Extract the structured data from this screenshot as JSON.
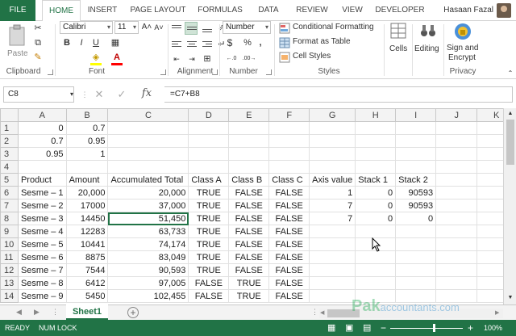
{
  "ribbon_tabs": [
    "FILE",
    "HOME",
    "INSERT",
    "PAGE LAYOUT",
    "FORMULAS",
    "DATA",
    "REVIEW",
    "VIEW",
    "DEVELOPER"
  ],
  "user_name": "Hasaan Fazal",
  "clipboard": {
    "paste_label": "Paste",
    "group_label": "Clipboard"
  },
  "font": {
    "name": "Calibri",
    "size": "11",
    "bold": "B",
    "italic": "I",
    "underline": "U",
    "group_label": "Font"
  },
  "alignment": {
    "group_label": "Alignment"
  },
  "number": {
    "format": "Number",
    "currency": "$",
    "percent": "%",
    "comma": ",",
    "group_label": "Number"
  },
  "styles": {
    "conditional": "Conditional Formatting",
    "format_table": "Format as Table",
    "cell_styles": "Cell Styles",
    "group_label": "Styles"
  },
  "cells": {
    "label": "Cells"
  },
  "editing": {
    "label": "Editing"
  },
  "privacy": {
    "sign_label": "Sign and",
    "encrypt_label": "Encrypt",
    "group_label": "Privacy"
  },
  "name_box": "C8",
  "formula": "=C7+B8",
  "fx_label": "fx",
  "columns": [
    "A",
    "B",
    "C",
    "D",
    "E",
    "F",
    "G",
    "H",
    "I",
    "J",
    "K"
  ],
  "rows": [
    {
      "n": "1",
      "cells": [
        "0",
        "0.7",
        "",
        "",
        "",
        "",
        "",
        "",
        "",
        "",
        ""
      ]
    },
    {
      "n": "2",
      "cells": [
        "0.7",
        "0.95",
        "",
        "",
        "",
        "",
        "",
        "",
        "",
        "",
        ""
      ]
    },
    {
      "n": "3",
      "cells": [
        "0.95",
        "1",
        "",
        "",
        "",
        "",
        "",
        "",
        "",
        "",
        ""
      ]
    },
    {
      "n": "4",
      "cells": [
        "",
        "",
        "",
        "",
        "",
        "",
        "",
        "",
        "",
        "",
        ""
      ]
    },
    {
      "n": "5",
      "cells": [
        "Product",
        "Amount",
        "Accumulated Total",
        "Class A",
        "Class B",
        "Class C",
        "Axis value",
        "Stack 1",
        "Stack 2",
        "",
        ""
      ]
    },
    {
      "n": "6",
      "cells": [
        "Sesme – 1",
        "20,000",
        "20,000",
        "TRUE",
        "FALSE",
        "FALSE",
        "1",
        "0",
        "90593",
        "",
        ""
      ]
    },
    {
      "n": "7",
      "cells": [
        "Sesme – 2",
        "17000",
        "37,000",
        "TRUE",
        "FALSE",
        "FALSE",
        "7",
        "0",
        "90593",
        "",
        ""
      ]
    },
    {
      "n": "8",
      "cells": [
        "Sesme – 3",
        "14450",
        "51,450",
        "TRUE",
        "FALSE",
        "FALSE",
        "7",
        "0",
        "0",
        "",
        ""
      ]
    },
    {
      "n": "9",
      "cells": [
        "Sesme – 4",
        "12283",
        "63,733",
        "TRUE",
        "FALSE",
        "FALSE",
        "",
        "",
        "",
        "",
        ""
      ]
    },
    {
      "n": "10",
      "cells": [
        "Sesme – 5",
        "10441",
        "74,174",
        "TRUE",
        "FALSE",
        "FALSE",
        "",
        "",
        "",
        "",
        ""
      ]
    },
    {
      "n": "11",
      "cells": [
        "Sesme – 6",
        "8875",
        "83,049",
        "TRUE",
        "FALSE",
        "FALSE",
        "",
        "",
        "",
        "",
        ""
      ]
    },
    {
      "n": "12",
      "cells": [
        "Sesme – 7",
        "7544",
        "90,593",
        "TRUE",
        "FALSE",
        "FALSE",
        "",
        "",
        "",
        "",
        ""
      ]
    },
    {
      "n": "13",
      "cells": [
        "Sesme – 8",
        "6412",
        "97,005",
        "FALSE",
        "TRUE",
        "FALSE",
        "",
        "",
        "",
        "",
        ""
      ]
    },
    {
      "n": "14",
      "cells": [
        "Sesme – 9",
        "5450",
        "102,455",
        "FALSE",
        "TRUE",
        "FALSE",
        "",
        "",
        "",
        "",
        ""
      ]
    }
  ],
  "sheet_tab": "Sheet1",
  "status": {
    "ready": "READY",
    "num_lock": "NUM LOCK",
    "zoom": "100%"
  },
  "watermark": {
    "main": "Pak",
    "sub": "accountants.com"
  },
  "colors": {
    "accent": "#217346"
  }
}
